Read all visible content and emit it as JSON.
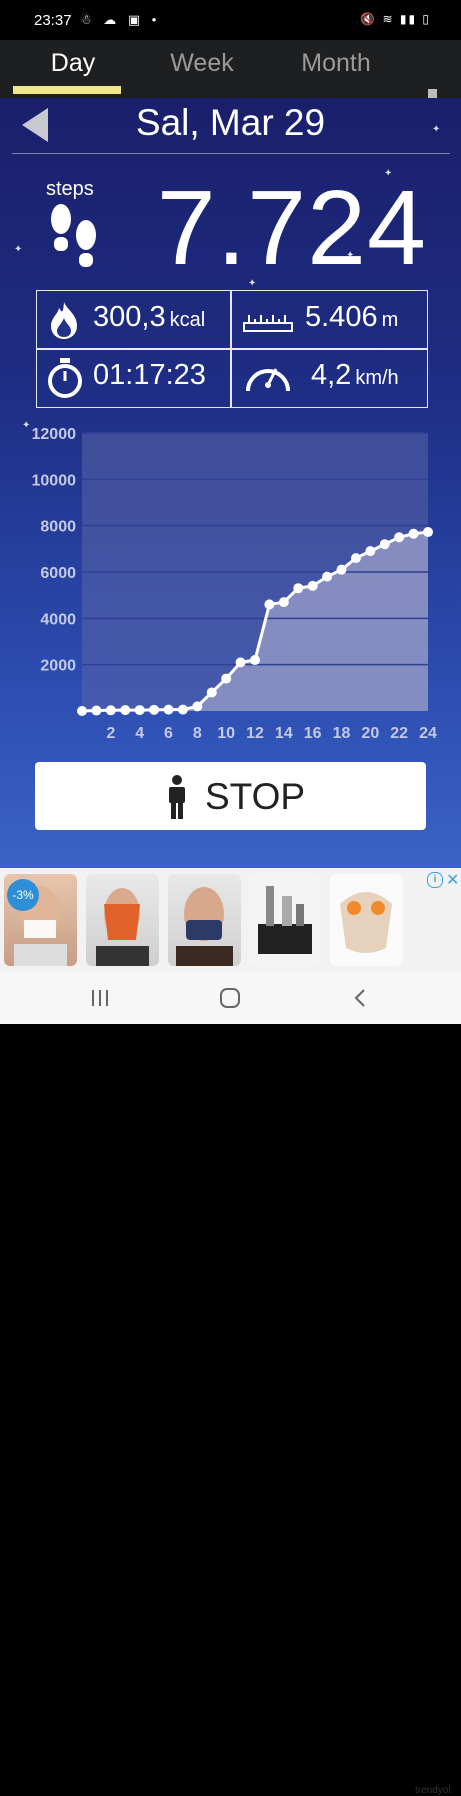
{
  "status_bar": {
    "time": "23:37"
  },
  "tabs": [
    {
      "label": "Day",
      "active": true
    },
    {
      "label": "Week",
      "active": false
    },
    {
      "label": "Month",
      "active": false
    }
  ],
  "header": {
    "date": "Sal, Mar 29"
  },
  "steps": {
    "label": "steps",
    "value": "7.724"
  },
  "stats": {
    "calories": {
      "value": "300,3",
      "unit": "kcal"
    },
    "distance": {
      "value": "5.406",
      "unit": "m"
    },
    "duration": {
      "value": "01:17:23"
    },
    "speed": {
      "value": "4,2",
      "unit": "km/h"
    }
  },
  "chart_data": {
    "type": "area",
    "x": [
      0,
      1,
      2,
      3,
      4,
      5,
      6,
      7,
      8,
      9,
      10,
      11,
      12,
      13,
      14,
      15,
      16,
      17,
      18,
      19,
      20,
      21,
      22,
      23,
      24
    ],
    "series": [
      {
        "values": [
          0,
          20,
          30,
          40,
          40,
          50,
          60,
          60,
          200,
          800,
          1400,
          2100,
          2200,
          4600,
          4700,
          5300,
          5400,
          5800,
          6100,
          6600,
          6900,
          7200,
          7500,
          7650,
          7724
        ]
      }
    ],
    "ylim": [
      0,
      12000
    ],
    "y_ticks": [
      "2000",
      "4000",
      "6000",
      "8000",
      "10000",
      "12000"
    ],
    "x_ticks": [
      "2",
      "4",
      "6",
      "8",
      "10",
      "12",
      "14",
      "16",
      "18",
      "20",
      "22",
      "24"
    ],
    "colors": {
      "area": "#8f97c6",
      "line": "#ffffff",
      "grid": "#2f3f93",
      "tick": "#c3c9e6"
    }
  },
  "stop_button": {
    "label": "STOP"
  },
  "ad": {
    "badge": "-3%",
    "brand": "trendyol"
  }
}
